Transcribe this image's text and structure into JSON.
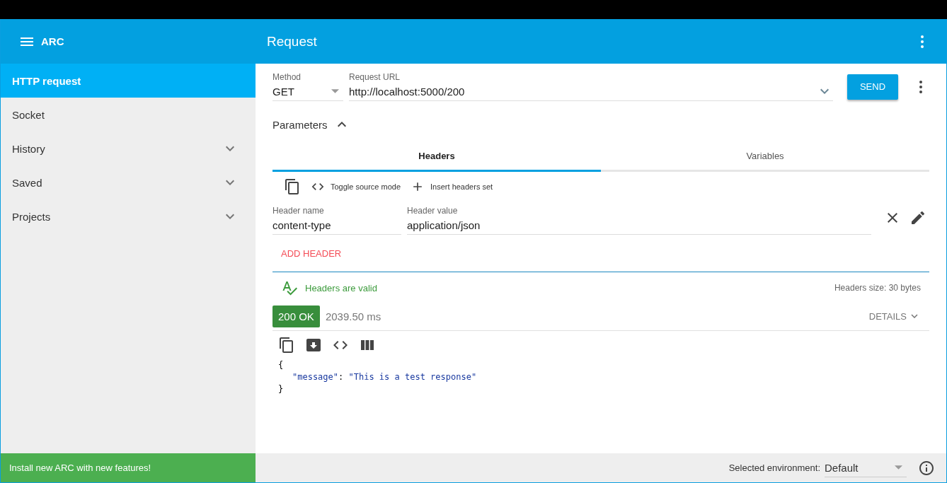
{
  "app": {
    "name": "ARC"
  },
  "header": {
    "title": "Request"
  },
  "sidebar": {
    "items": [
      {
        "label": "HTTP request",
        "selected": true,
        "expandable": false
      },
      {
        "label": "Socket",
        "selected": false,
        "expandable": false
      },
      {
        "label": "History",
        "selected": false,
        "expandable": true
      },
      {
        "label": "Saved",
        "selected": false,
        "expandable": true
      },
      {
        "label": "Projects",
        "selected": false,
        "expandable": true
      }
    ],
    "banner": "Install new ARC with new features!"
  },
  "request": {
    "method_label": "Method",
    "method": "GET",
    "url_label": "Request URL",
    "url": "http://localhost:5000/200",
    "send": "SEND"
  },
  "parameters": {
    "label": "Parameters",
    "expanded": true,
    "tabs": [
      {
        "label": "Headers",
        "selected": true
      },
      {
        "label": "Variables",
        "selected": false
      }
    ],
    "toolbar": [
      {
        "kind": "copy"
      },
      {
        "kind": "code",
        "label": "Toggle source mode"
      },
      {
        "kind": "add",
        "label": "Insert headers set"
      }
    ],
    "headers": [
      {
        "name_label": "Header name",
        "name": "content-type",
        "value_label": "Header value",
        "value": "application/json"
      }
    ],
    "add_header": "ADD HEADER",
    "validation": "Headers are valid",
    "size": "Headers size: 30 bytes"
  },
  "response": {
    "status": "200 OK",
    "time": "2039.50 ms",
    "details": "DETAILS",
    "toolbar": [
      {
        "kind": "copy"
      },
      {
        "kind": "save"
      },
      {
        "kind": "code"
      },
      {
        "kind": "columns"
      }
    ],
    "body": [
      [
        {
          "kind": "punct",
          "text": "{"
        }
      ],
      [
        {
          "kind": "string",
          "text": "\"message\""
        },
        {
          "kind": "punct",
          "text": ": "
        },
        {
          "kind": "string",
          "text": "\"This is a test response\""
        }
      ],
      [
        {
          "kind": "punct",
          "text": "}"
        }
      ]
    ]
  },
  "footer": {
    "env_label": "Selected environment:",
    "env": "Default"
  }
}
